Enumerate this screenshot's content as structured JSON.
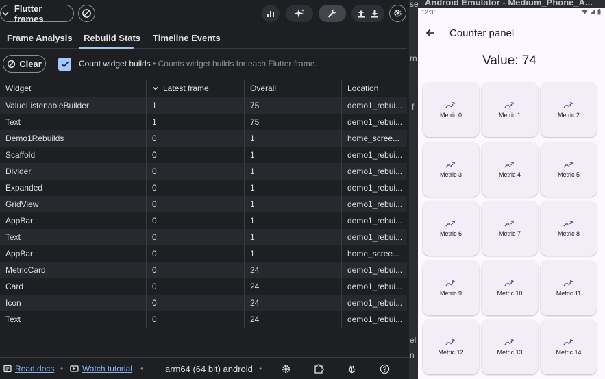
{
  "devtools": {
    "title_pill": "Flutter frames",
    "tabs": [
      "Frame Analysis",
      "Rebuild Stats",
      "Timeline Events"
    ],
    "clear_label": "Clear",
    "checkbox_label": "Count widget builds",
    "checkbox_desc": " • Counts widget builds for each Flutter frame.",
    "table": {
      "headers": [
        "Widget",
        "Latest frame",
        "Overall",
        "Location"
      ],
      "rows": [
        [
          "ValueListenableBuilder",
          "1",
          "75",
          "demo1_rebui..."
        ],
        [
          "Text",
          "1",
          "75",
          "demo1_rebui..."
        ],
        [
          "Demo1Rebuilds",
          "0",
          "1",
          "home_scree..."
        ],
        [
          "Scaffold",
          "0",
          "1",
          "demo1_rebui..."
        ],
        [
          "Divider",
          "0",
          "1",
          "demo1_rebui..."
        ],
        [
          "Expanded",
          "0",
          "1",
          "demo1_rebui..."
        ],
        [
          "GridView",
          "0",
          "1",
          "demo1_rebui..."
        ],
        [
          "AppBar",
          "0",
          "1",
          "demo1_rebui..."
        ],
        [
          "Text",
          "0",
          "1",
          "demo1_rebui..."
        ],
        [
          "AppBar",
          "0",
          "1",
          "home_scree..."
        ],
        [
          "MetricCard",
          "0",
          "24",
          "demo1_rebui..."
        ],
        [
          "Card",
          "0",
          "24",
          "demo1_rebui..."
        ],
        [
          "Icon",
          "0",
          "24",
          "demo1_rebui..."
        ],
        [
          "Text",
          "0",
          "24",
          "demo1_rebui..."
        ]
      ]
    },
    "bottom": {
      "read_docs": "Read docs",
      "watch_tutorial": "Watch tutorial",
      "device": "arm64 (64 bit) android",
      "sep": "•"
    }
  },
  "strip_fragments": [
    "se",
    "rn",
    "f",
    "el",
    "n"
  ],
  "emulator": {
    "window_title": "Android Emulator - Medium_Phone_A...",
    "status_time": "12:35",
    "app_title": "Counter panel",
    "value_text": "Value: 74",
    "cards": [
      "Metric 0",
      "Metric 1",
      "Metric 2",
      "Metric 3",
      "Metric 4",
      "Metric 5",
      "Metric 6",
      "Metric 7",
      "Metric 8",
      "Metric 9",
      "Metric 10",
      "Metric 11",
      "Metric 12",
      "Metric 13",
      "Metric 14"
    ]
  },
  "colors": {
    "accent": "#a6c2f5",
    "link": "#8ab4f8",
    "card_bg": "#f3edf7",
    "icon_blue": "#3e4e8c"
  }
}
